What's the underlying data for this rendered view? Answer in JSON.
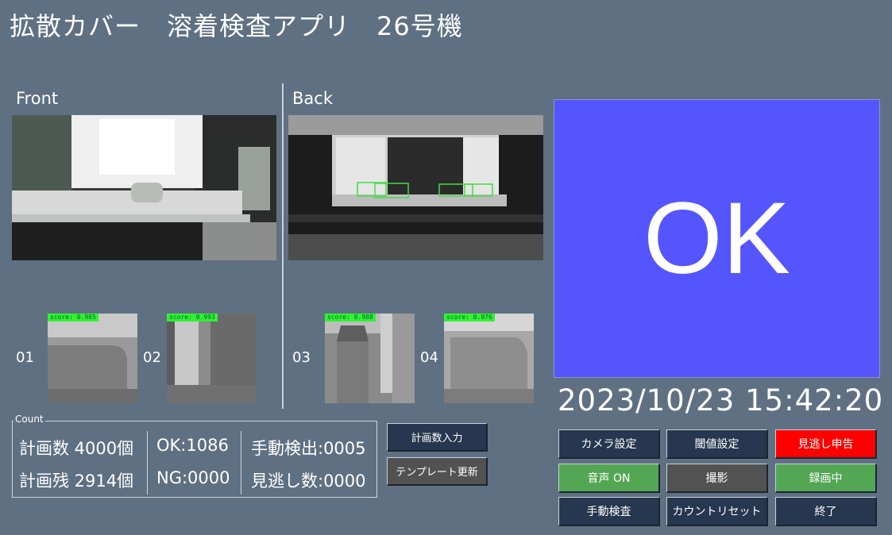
{
  "header": {
    "title": "拡散カバー　溶着検査アプリ　26号機"
  },
  "cameras": {
    "front_label": "Front",
    "back_label": "Back"
  },
  "crops": [
    {
      "id": "01",
      "score": "score: 0.985"
    },
    {
      "id": "02",
      "score": "score: 0.993"
    },
    {
      "id": "03",
      "score": "score: 0.988"
    },
    {
      "id": "04",
      "score": "score: 0.976"
    }
  ],
  "result": {
    "text": "OK",
    "color": "#5555ff"
  },
  "datetime": "2023/10/23 15:42:20",
  "count": {
    "legend": "Count",
    "plan": "計画数 4000個",
    "remaining": "計画残 2914個",
    "ok": "OK:1086",
    "ng": "NG:0000",
    "manual_detect": "手動検出:0005",
    "missed": "見逃し数:0000"
  },
  "side_buttons": {
    "plan_input": "計画数入力",
    "template_update": "テンプレート更新"
  },
  "buttons": {
    "camera_settings": "カメラ設定",
    "threshold_settings": "閾値設定",
    "report_missed": "見逃し申告",
    "sound_on": "音声 ON",
    "capture": "撮影",
    "recording": "録画中",
    "manual_inspect": "手動検査",
    "count_reset": "カウントリセット",
    "exit": "終了"
  },
  "colors": {
    "background": "#5f7083",
    "ok_panel": "#5555ff",
    "button_navy": "#26374f",
    "button_gray": "#525252",
    "button_green": "#53a653",
    "button_red": "#ff0000",
    "score_tag": "#31f231"
  }
}
